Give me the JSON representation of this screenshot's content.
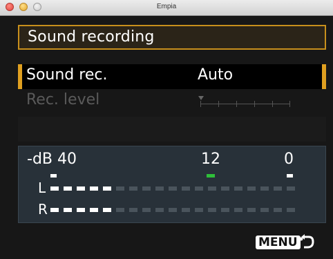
{
  "window": {
    "title": "Empia"
  },
  "menu": {
    "header": "Sound recording",
    "rows": [
      {
        "label": "Sound rec.",
        "value": "Auto",
        "selected": true
      },
      {
        "label": "Rec. level",
        "value": "",
        "disabled": true
      }
    ]
  },
  "meter": {
    "db_label": "-dB",
    "scale": [
      "40",
      "12",
      "0"
    ],
    "channels": [
      {
        "label": "L",
        "lit_segments": 5,
        "total_segments": 19
      },
      {
        "label": "R",
        "lit_segments": 5,
        "total_segments": 19
      }
    ]
  },
  "footer": {
    "menu_key": "MENU",
    "return_icon": "return-arrow-icon"
  },
  "colors": {
    "accent": "#e0a020",
    "meter_bg": "#283139",
    "meter_green": "#2fbf3a"
  }
}
